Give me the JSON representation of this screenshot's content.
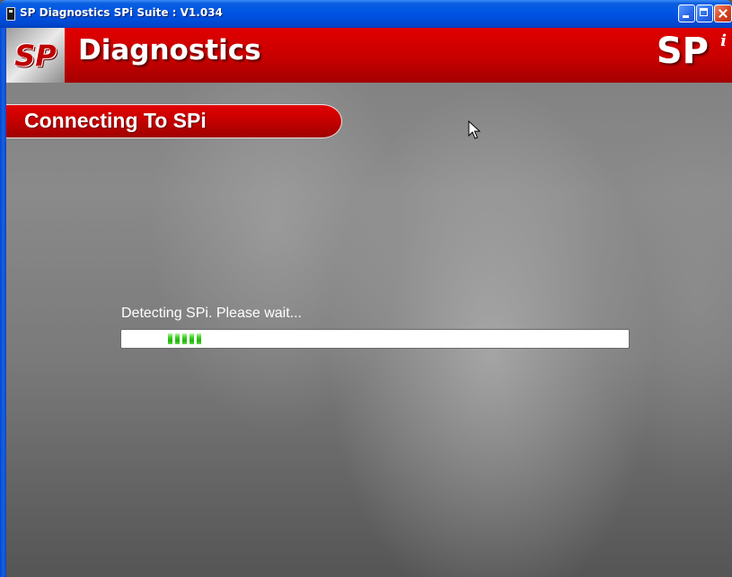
{
  "window": {
    "title": "SP Diagnostics SPi Suite : V1.034"
  },
  "header": {
    "logo_text": "SP",
    "title": "Diagnostics",
    "brand": "SP",
    "brand_superscript": "i"
  },
  "section": {
    "title": "Connecting To SPi"
  },
  "status": {
    "message": "Detecting SPi. Please wait...",
    "progress_style": "marquee",
    "progress_segments": 5,
    "progress_color": "#2bc214"
  },
  "colors": {
    "banner_red": "#c80000",
    "titlebar_blue": "#0055e5",
    "background_gray": "#7f7f7f"
  },
  "icons": [
    "app-icon",
    "minimize-icon",
    "maximize-icon",
    "close-icon",
    "mouse-pointer-icon"
  ]
}
